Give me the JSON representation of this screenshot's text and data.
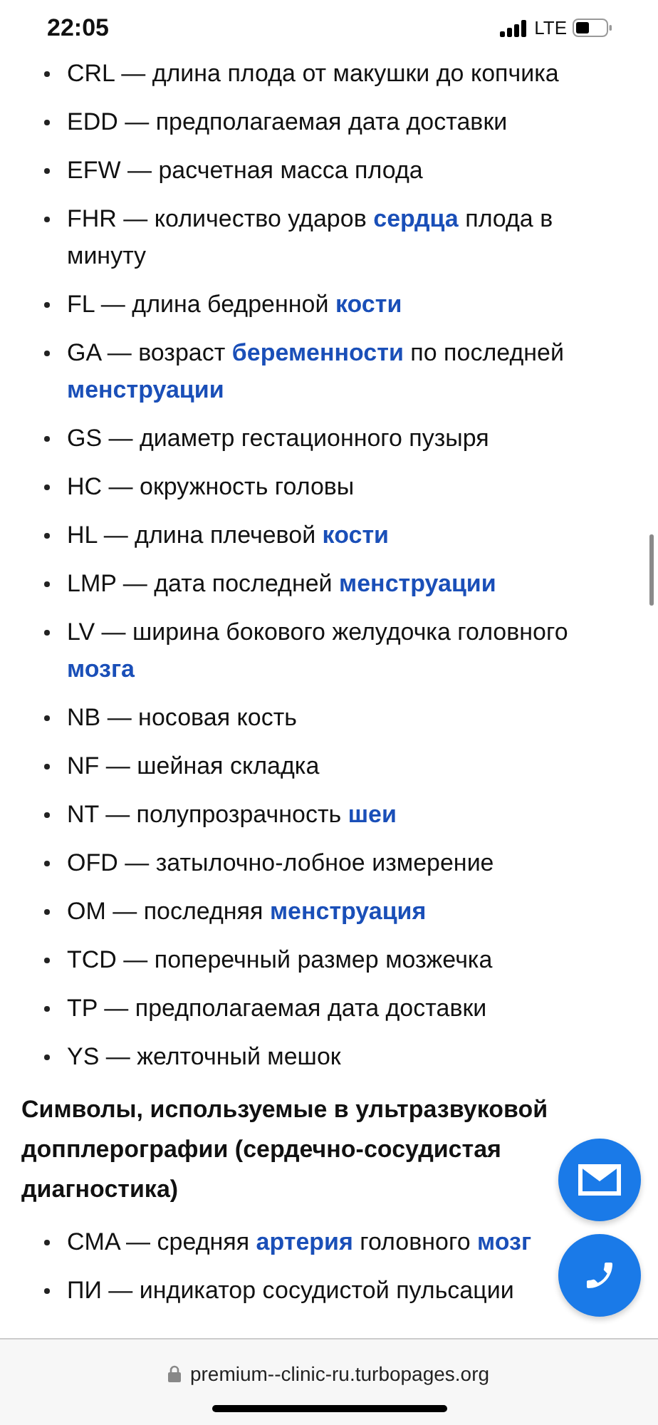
{
  "status_bar": {
    "time": "22:05",
    "network": "LTE"
  },
  "terms": [
    {
      "parts": [
        {
          "text": "CRL — длина плода от макушки до копчика",
          "link": false
        }
      ]
    },
    {
      "parts": [
        {
          "text": "EDD — предполагаемая дата доставки",
          "link": false
        }
      ]
    },
    {
      "parts": [
        {
          "text": "EFW — расчетная масса плода",
          "link": false
        }
      ]
    },
    {
      "parts": [
        {
          "text": "FHR — количество ударов ",
          "link": false
        },
        {
          "text": "сердца",
          "link": true
        },
        {
          "text": " плода в минуту",
          "link": false
        }
      ]
    },
    {
      "parts": [
        {
          "text": "FL — длина бедренной ",
          "link": false
        },
        {
          "text": "кости",
          "link": true
        }
      ]
    },
    {
      "parts": [
        {
          "text": "GA — возраст ",
          "link": false
        },
        {
          "text": "беременности",
          "link": true
        },
        {
          "text": " по последней ",
          "link": false
        },
        {
          "text": "менструации",
          "link": true
        }
      ]
    },
    {
      "parts": [
        {
          "text": "GS — диаметр гестационного пузыря",
          "link": false
        }
      ]
    },
    {
      "parts": [
        {
          "text": "HC — окружность головы",
          "link": false
        }
      ]
    },
    {
      "parts": [
        {
          "text": "HL — длина плечевой ",
          "link": false
        },
        {
          "text": "кости",
          "link": true
        }
      ]
    },
    {
      "parts": [
        {
          "text": "LMP — дата последней ",
          "link": false
        },
        {
          "text": "менструации",
          "link": true
        }
      ]
    },
    {
      "parts": [
        {
          "text": "LV — ширина бокового желудочка головного ",
          "link": false
        },
        {
          "text": "мозга",
          "link": true
        }
      ]
    },
    {
      "parts": [
        {
          "text": "NB — носовая кость",
          "link": false
        }
      ]
    },
    {
      "parts": [
        {
          "text": "NF — шейная складка",
          "link": false
        }
      ]
    },
    {
      "parts": [
        {
          "text": "NT — полупрозрачность ",
          "link": false
        },
        {
          "text": "шеи",
          "link": true
        }
      ]
    },
    {
      "parts": [
        {
          "text": "OFD — затылочно-лобное измерение",
          "link": false
        }
      ]
    },
    {
      "parts": [
        {
          "text": "OM — последняя ",
          "link": false
        },
        {
          "text": "менструация",
          "link": true
        }
      ]
    },
    {
      "parts": [
        {
          "text": "TCD — поперечный размер мозжечка",
          "link": false
        }
      ]
    },
    {
      "parts": [
        {
          "text": "TP — предполагаемая дата доставки",
          "link": false
        }
      ]
    },
    {
      "parts": [
        {
          "text": "YS — желточный мешок",
          "link": false
        }
      ]
    }
  ],
  "section_heading": "Символы, используемые в ультразвуковой допплерографии (сердечно-сосудистая диагностика)",
  "doppler_terms": [
    {
      "parts": [
        {
          "text": "CMA — средняя ",
          "link": false
        },
        {
          "text": "артерия",
          "link": true
        },
        {
          "text": " головного ",
          "link": false
        },
        {
          "text": "мозг",
          "link": true
        }
      ]
    },
    {
      "parts": [
        {
          "text": "ПИ — индикатор сосудистой пульсации",
          "link": false
        }
      ]
    }
  ],
  "address_bar": {
    "url": "premium--clinic-ru.turbopages.org"
  }
}
